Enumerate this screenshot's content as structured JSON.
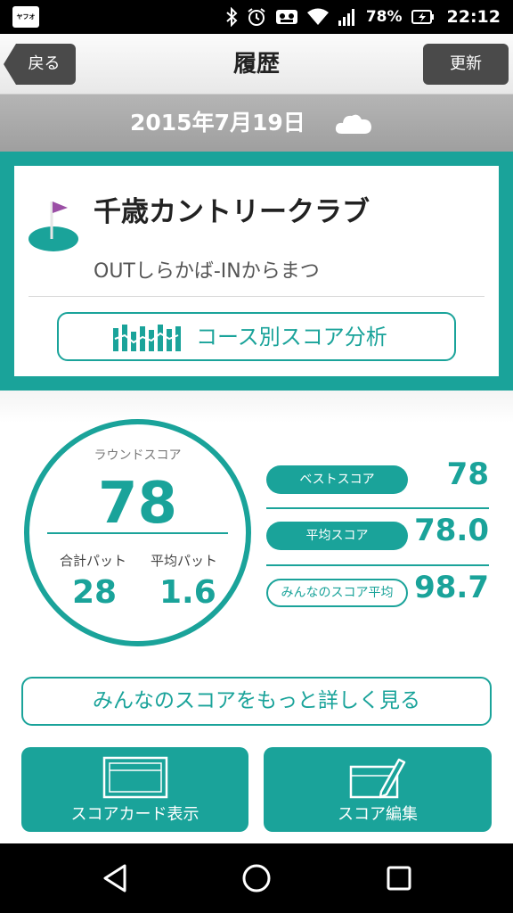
{
  "status_bar": {
    "app_icon_text": "ヤフオク!",
    "battery": "78%",
    "time": "22:12"
  },
  "nav": {
    "back_label": "戻る",
    "title": "履歴",
    "refresh_label": "更新"
  },
  "date_bar": {
    "date": "2015年7月19日",
    "weather_icon": "cloud-icon"
  },
  "course": {
    "name": "千歳カントリークラブ",
    "sub": "OUTしらかば-INからまつ",
    "analysis_button": "コース別スコア分析"
  },
  "round": {
    "label": "ラウンドスコア",
    "score": "78",
    "total_putts_label": "合計パット",
    "total_putts": "28",
    "avg_putts_label": "平均パット",
    "avg_putts": "1.6"
  },
  "stats": [
    {
      "label": "ベストスコア",
      "value": "78"
    },
    {
      "label": "平均スコア",
      "value": "78.0"
    },
    {
      "label": "みんなのスコア平均",
      "value": "98.7"
    }
  ],
  "more_button": "みんなのスコアをもっと詳しく見る",
  "tiles": {
    "scorecard_label": "スコアカード表示",
    "edit_label": "スコア編集"
  },
  "colors": {
    "accent": "#1aa39a",
    "dark_button": "#4a4a4a",
    "date_bar": "#a8a8a8"
  }
}
